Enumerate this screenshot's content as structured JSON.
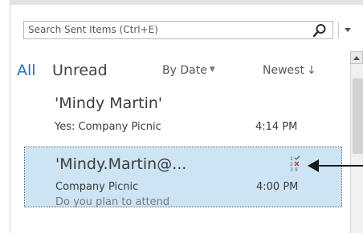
{
  "search": {
    "placeholder": "Search Sent Items (Ctrl+E)"
  },
  "filters": {
    "all": "All",
    "unread": "Unread",
    "sort_by": "By Date",
    "order": "Newest"
  },
  "messages": [
    {
      "sender": "'Mindy Martin'",
      "subject": "Yes: Company Picnic",
      "time": "4:14 PM",
      "preview": ""
    },
    {
      "sender": "'Mindy.Martin@...",
      "subject": "Company Picnic",
      "time": "4:00 PM",
      "preview": "Do you plan to attend",
      "selected": true,
      "icon": "voting-icon"
    }
  ],
  "colors": {
    "accent": "#1e74c7",
    "selection": "#cde4f4"
  }
}
